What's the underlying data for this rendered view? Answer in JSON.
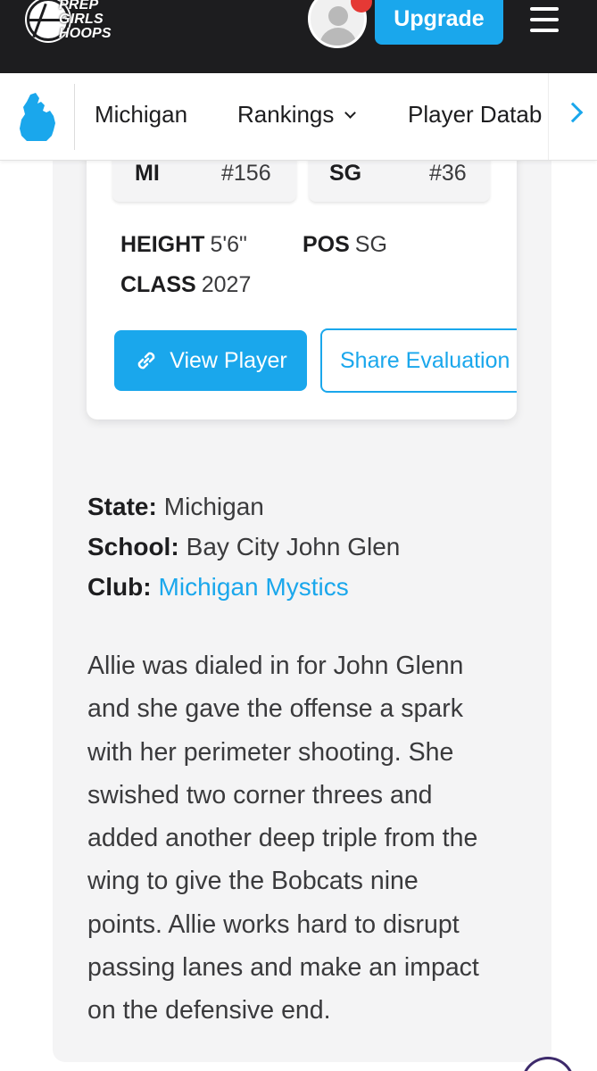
{
  "header": {
    "logo_lines": [
      "PREP",
      "GIRLS",
      "HOOPS"
    ],
    "upgrade_label": "Upgrade",
    "colors": {
      "background": "#1d1d1f",
      "accent": "#1aa7ec",
      "notification": "#e53935"
    }
  },
  "subnav": {
    "items": [
      {
        "label": "Michigan"
      },
      {
        "label": "Rankings"
      },
      {
        "label": "Player Datab"
      }
    ]
  },
  "player_card": {
    "rankings": [
      {
        "label": "MI",
        "value": "#156"
      },
      {
        "label": "SG",
        "value": "#36"
      }
    ],
    "attributes": {
      "height_label": "HEIGHT",
      "height_value": "5'6\"",
      "pos_label": "POS",
      "pos_value": "SG",
      "class_label": "CLASS",
      "class_value": "2027"
    },
    "view_label": "View Player",
    "share_label": "Share Evaluation"
  },
  "details": {
    "state_label": "State:",
    "state_value": "Michigan",
    "school_label": "School:",
    "school_value": "Bay City John Glen",
    "club_label": "Club:",
    "club_value": "Michigan Mystics"
  },
  "evaluation": {
    "lines": [
      "Allie was dialed in for John Glenn",
      "and she gave the offense a spark",
      "with her perimeter shooting. She",
      "swished two corner threes and",
      "added another deep triple from the",
      "wing to give the Bobcats nine",
      "points. Allie works hard to disrupt",
      "passing lanes and make an impact",
      "on the defensive end."
    ]
  }
}
